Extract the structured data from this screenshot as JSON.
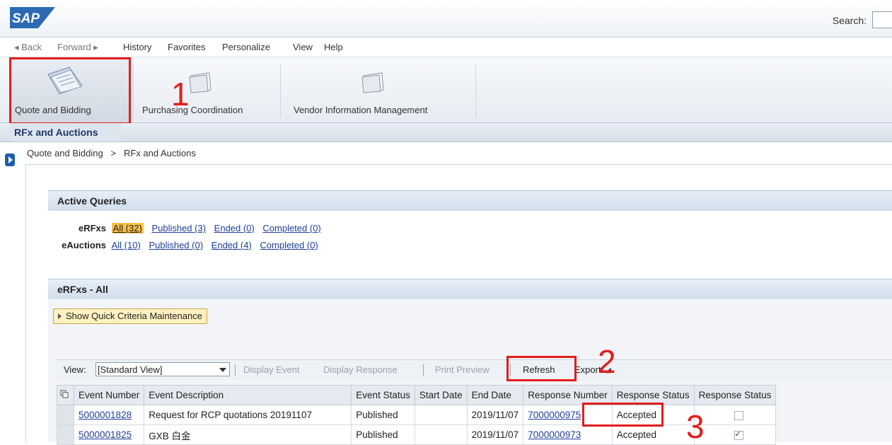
{
  "header": {
    "search_label": "Search:",
    "search_value": ""
  },
  "menu": {
    "back": "◂ Back",
    "forward": "Forward ▸",
    "items": [
      "History",
      "Favorites",
      "Personalize",
      "View",
      "Help"
    ]
  },
  "launchpad": {
    "tiles": [
      {
        "label": "Quote and Bidding"
      },
      {
        "label": "Purchasing Coordination"
      },
      {
        "label": "Vendor Information Management"
      }
    ]
  },
  "subtab": {
    "label": "RFx and Auctions"
  },
  "breadcrumb": {
    "part1": "Quote and Bidding",
    "sep": ">",
    "part2": "RFx and Auctions"
  },
  "annotations": {
    "n1": "1",
    "n2": "2",
    "n3": "3"
  },
  "active_queries": {
    "title": "Active Queries",
    "erfx_label": "eRFxs",
    "erfx_links": [
      "All (32)",
      "Published (3)",
      "Ended (0)",
      "Completed (0)"
    ],
    "eauction_label": "eAuctions",
    "eauction_links": [
      "All (10)",
      "Published (0)",
      "Ended (4)",
      "Completed (0)"
    ]
  },
  "erfx_panel": {
    "title": "eRFxs - All",
    "quick_criteria": "Show Quick Criteria Maintenance",
    "toolbar": {
      "view_label": "View:",
      "view_value": "[Standard View]",
      "display_event": "Display Event",
      "display_response": "Display Response",
      "print_preview": "Print Preview",
      "refresh": "Refresh",
      "export": "Export"
    },
    "columns": [
      "Event Number",
      "Event Description",
      "Event Status",
      "Start Date",
      "End Date",
      "Response Number",
      "Response Status",
      "Response Status"
    ],
    "rows": [
      {
        "event_number": "5000001828",
        "description": "Request for RCP quotations 20191107",
        "status": "Published",
        "start": "",
        "end": "2019/11/07",
        "response_number": "7000000975",
        "response_status": "Accepted",
        "checked": false
      },
      {
        "event_number": "5000001825",
        "description": "GXB 白金",
        "status": "Published",
        "start": "",
        "end": "2019/11/07",
        "response_number": "7000000973",
        "response_status": "Accepted",
        "checked": true
      }
    ]
  }
}
